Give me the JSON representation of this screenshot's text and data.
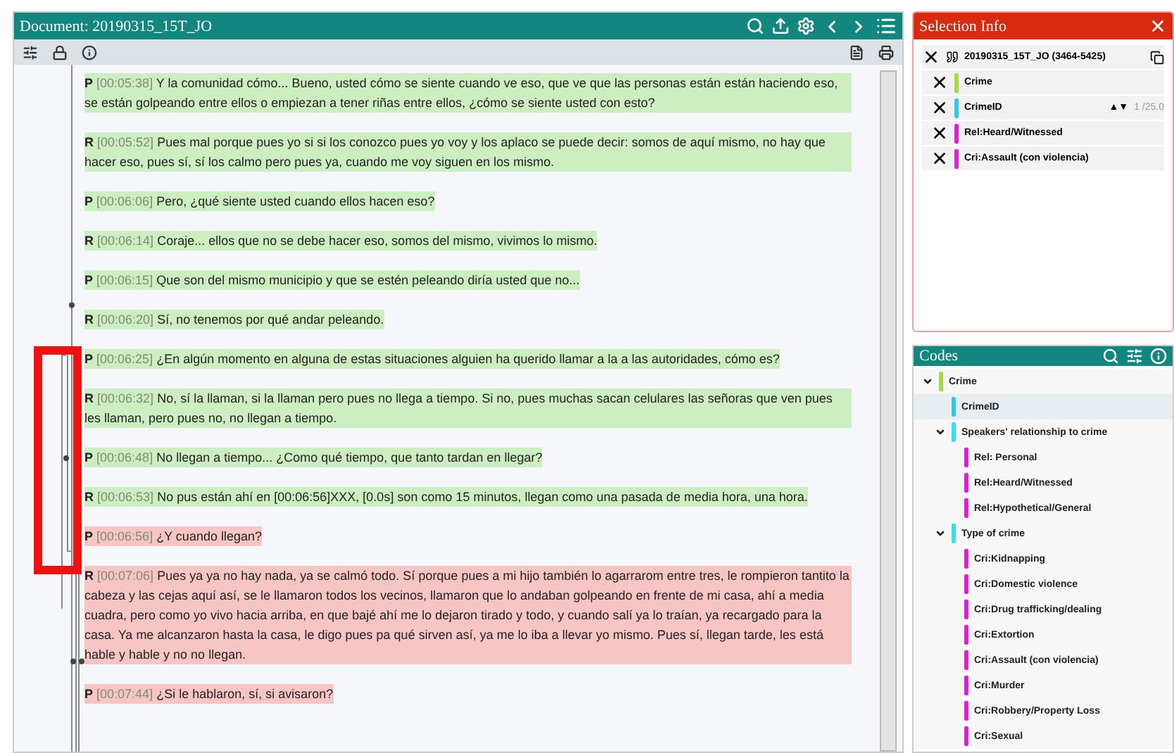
{
  "document": {
    "title": "Document: 20190315_15T_JO",
    "paragraphs": [
      {
        "speaker": "P",
        "time": "[00:05:38]",
        "text": "Y la comunidad cómo... Bueno, usted cómo se siente cuando ve eso, que ve que las personas están están haciendo eso, se están golpeando entre ellos o empiezan a tener riñas entre ellos, ¿cómo se siente usted con esto?",
        "color": "#cdeec0"
      },
      {
        "speaker": "R",
        "time": "[00:05:52]",
        "text": "Pues mal porque pues yo si si los conozco pues yo voy y los aplaco se puede decir: somos de aquí mismo, no hay que hacer eso, pues sí, sí los calmo pero pues ya, cuando me voy siguen en los mismo.",
        "color": "#cdeec0"
      },
      {
        "speaker": "P",
        "time": "[00:06:06]",
        "text": "Pero, ¿qué siente usted cuando ellos hacen eso?",
        "color": "#cdeec0"
      },
      {
        "speaker": "R",
        "time": "[00:06:14]",
        "text": "Coraje... ellos que no se debe hacer eso, somos del mismo, vivimos lo mismo.",
        "color": "#cdeec0"
      },
      {
        "speaker": "P",
        "time": "[00:06:15]",
        "text": "Que son del mismo municipio y que se estén peleando diría usted que no...",
        "color": "#cdeec0"
      },
      {
        "speaker": "R",
        "time": "[00:06:20]",
        "text": "Sí, no tenemos por qué andar peleando.",
        "color": "#cdeec0"
      },
      {
        "speaker": "P",
        "time": "[00:06:25]",
        "text": "¿En algún momento en alguna de estas situaciones alguien ha querido llamar a la a las autoridades, cómo es?",
        "color": "#cdeec0"
      },
      {
        "speaker": "R",
        "time": "[00:06:32]",
        "text": "No, sí la llaman, si la llaman pero pues no llega a tiempo. Si no, pues muchas sacan celulares las señoras que ven pues les llaman, pero pues no, no llegan a tiempo.",
        "color": "#cdeec0"
      },
      {
        "speaker": "P",
        "time": "[00:06:48]",
        "text": "No llegan a tiempo... ¿Como qué tiempo, que tanto tardan en llegar?",
        "color": "#cdeec0"
      },
      {
        "speaker": "R",
        "time": "[00:06:53]",
        "text": "No pus están ahí en [00:06:56]XXX, [0.0s] son como 15 minutos, llegan como una pasada de media hora, una hora.",
        "color": "#cdeec0"
      },
      {
        "speaker": "P",
        "time": "[00:06:56]",
        "text": "¿Y cuando llegan?",
        "color": "#f8c5c5"
      },
      {
        "speaker": "R",
        "time": "[00:07:06]",
        "text": "Pues ya ya no hay nada, ya se calmó todo. Sí porque pues a mi hijo también lo agarrarom entre tres, le rompieron tantito la cabeza y las cejas aquí así, se le llamaron todos los vecinos, llamaron que lo andaban golpeando en frente de mi casa, ahí a media cuadra, pero como yo vivo hacia arriba, en que bajé ahí me lo dejaron tirado y todo, y cuando salí ya lo traían, ya recargado para la casa. Ya me alcanzaron hasta la casa, le digo pues pa qué sirven así, ya me lo iba a llevar yo mismo. Pues sí, llegan tarde, les está hable y hable y no no llegan.",
        "color": "#f8c5c5"
      },
      {
        "speaker": "P",
        "time": "[00:07:44]",
        "text": "¿Si le hablaron, sí, si avisaron?",
        "color": "#f8c5c5"
      }
    ]
  },
  "selection_info": {
    "title": "Selection Info",
    "quotation": "20190315_15T_JO (3464-5425)",
    "codes": [
      {
        "label": "Crime",
        "color": "#a6d84a",
        "kind": "plain"
      },
      {
        "label": "CrimeID",
        "color": "#33c8e8",
        "kind": "value",
        "arrows": "▲▼",
        "value": "1 /25.0"
      },
      {
        "label": "Rel:Heard/Witnessed",
        "color": "#e020d0",
        "kind": "plain"
      },
      {
        "label": "Cri:Assault (con violencia)",
        "color": "#e020d0",
        "kind": "plain"
      }
    ]
  },
  "codes": {
    "title": "Codes",
    "tree": [
      {
        "label": "Crime",
        "color": "#a6d84a",
        "expanded": true,
        "children": [
          {
            "label": "CrimeID",
            "color": "#33c8e8",
            "selected": true
          },
          {
            "label": "Speakers' relationship to crime",
            "color": "#33e0f0",
            "expanded": true,
            "children": [
              {
                "label": "Rel: Personal",
                "color": "#e020d0"
              },
              {
                "label": "Rel:Heard/Witnessed",
                "color": "#e020d0"
              },
              {
                "label": "Rel:Hypothetical/General",
                "color": "#e020d0"
              }
            ]
          },
          {
            "label": "Type of crime",
            "color": "#33e0f0",
            "expanded": true,
            "children": [
              {
                "label": "Cri:Kidnapping",
                "color": "#e020d0"
              },
              {
                "label": "Cri:Domestic violence",
                "color": "#e020d0"
              },
              {
                "label": "Cri:Drug trafficking/dealing",
                "color": "#e020d0"
              },
              {
                "label": "Cri:Extortion",
                "color": "#e020d0"
              },
              {
                "label": "Cri:Assault (con violencia)",
                "color": "#e020d0"
              },
              {
                "label": "Cri:Murder",
                "color": "#e020d0"
              },
              {
                "label": "Cri:Robbery/Property Loss",
                "color": "#e020d0"
              },
              {
                "label": "Cri:Sexual",
                "color": "#e020d0"
              }
            ]
          }
        ]
      }
    ]
  }
}
